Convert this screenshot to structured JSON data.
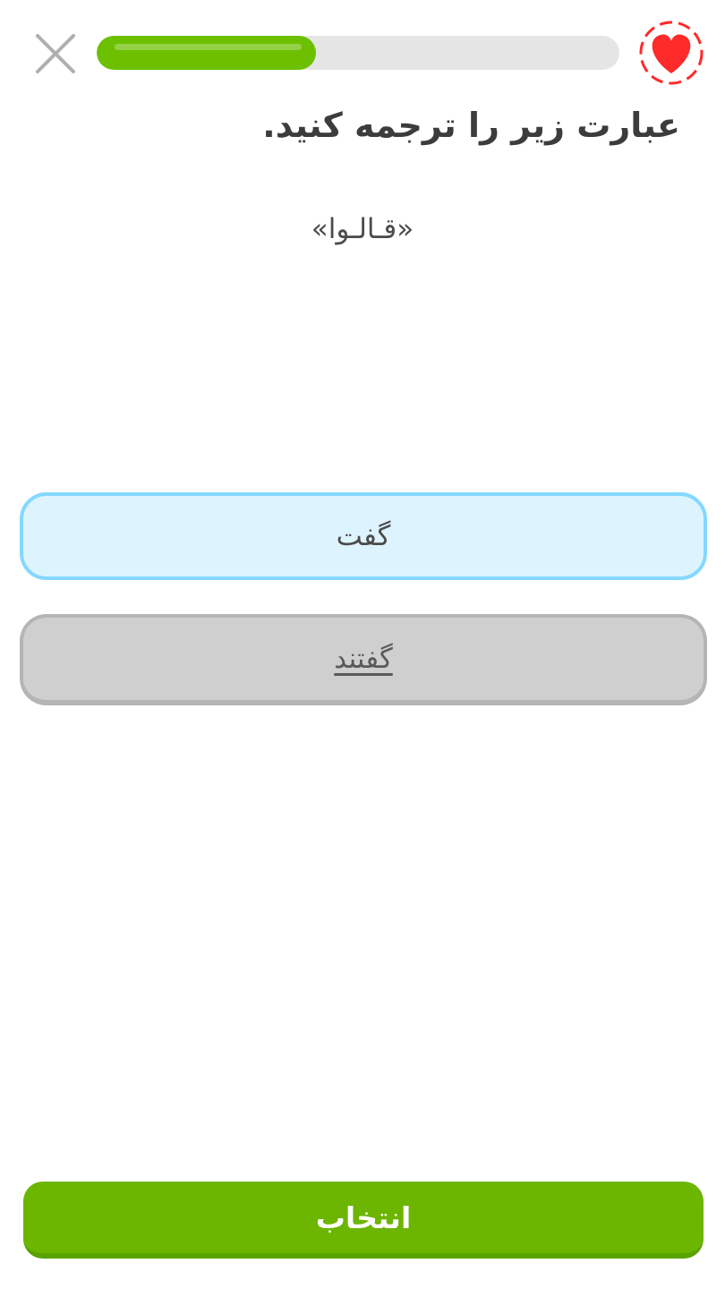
{
  "header": {
    "close_icon": "close-icon",
    "progress": 0.42,
    "progress_color": "#6cc000",
    "track_color": "#e5e5e5",
    "heart_icon": "heart-icon",
    "heart_color": "#ff2a2a"
  },
  "exercise": {
    "prompt": "عبارت زیر را ترجمه کنید.",
    "phrase": "«قـالـوا»"
  },
  "choices": [
    {
      "label": "گفت",
      "state": "selected"
    },
    {
      "label": "گفتند",
      "state": "unselected"
    }
  ],
  "footer": {
    "submit_label": "انتخاب",
    "submit_color": "#6cb500"
  }
}
